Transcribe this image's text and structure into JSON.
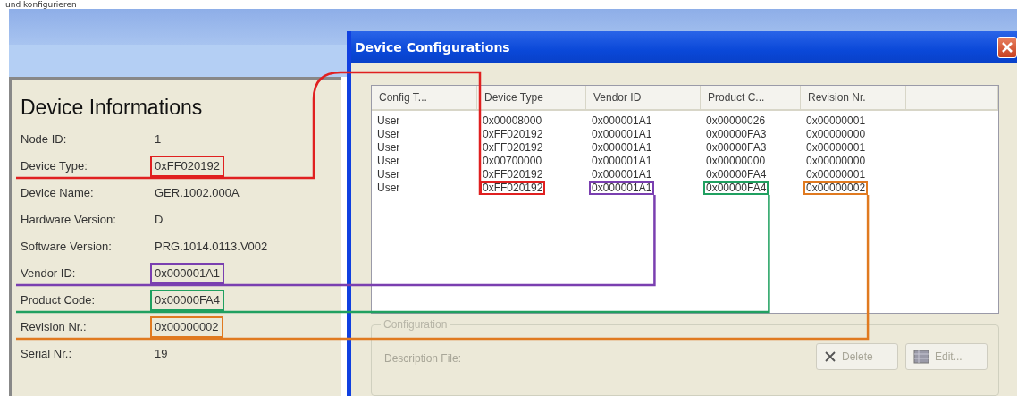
{
  "top_note": "und konfigurieren",
  "device_info": {
    "title": "Device Informations",
    "rows": [
      {
        "label": "Node ID:",
        "value": "1"
      },
      {
        "label": "Device Type:",
        "value": "0xFF020192",
        "color": "#e02020"
      },
      {
        "label": "Device Name:",
        "value": "GER.1002.000A"
      },
      {
        "label": "Hardware Version:",
        "value": "D"
      },
      {
        "label": "Software Version:",
        "value": "PRG.1014.0113.V002"
      },
      {
        "label": "Vendor ID:",
        "value": "0x000001A1",
        "color": "#7a3fb0"
      },
      {
        "label": "Product Code:",
        "value": "0x00000FA4",
        "color": "#20a060"
      },
      {
        "label": "Revision Nr.:",
        "value": "0x00000002",
        "color": "#e07a20"
      },
      {
        "label": "Serial Nr.:",
        "value": "19"
      }
    ]
  },
  "dialog": {
    "title": "Device Configurations",
    "table": {
      "columns": [
        "Config T...",
        "Device Type",
        "Vendor ID",
        "Product C...",
        "Revision Nr."
      ],
      "rows": [
        {
          "cells": [
            {
              "text": "User"
            },
            {
              "text": "0x00008000"
            },
            {
              "text": "0x000001A1"
            },
            {
              "text": "0x00000026"
            },
            {
              "text": "0x00000001"
            }
          ]
        },
        {
          "cells": [
            {
              "text": "User"
            },
            {
              "text": "0xFF020192"
            },
            {
              "text": "0x000001A1"
            },
            {
              "text": "0x00000FA3"
            },
            {
              "text": "0x00000000"
            }
          ]
        },
        {
          "cells": [
            {
              "text": "User"
            },
            {
              "text": "0xFF020192"
            },
            {
              "text": "0x000001A1"
            },
            {
              "text": "0x00000FA3"
            },
            {
              "text": "0x00000001"
            }
          ]
        },
        {
          "cells": [
            {
              "text": "User"
            },
            {
              "text": "0x00700000"
            },
            {
              "text": "0x000001A1"
            },
            {
              "text": "0x00000000"
            },
            {
              "text": "0x00000000"
            }
          ]
        },
        {
          "cells": [
            {
              "text": "User"
            },
            {
              "text": "0xFF020192"
            },
            {
              "text": "0x000001A1"
            },
            {
              "text": "0x00000FA4"
            },
            {
              "text": "0x00000001"
            }
          ]
        },
        {
          "cells": [
            {
              "text": "User"
            },
            {
              "text": "0xFF020192",
              "color": "#e02020"
            },
            {
              "text": "0x000001A1",
              "color": "#7a3fb0"
            },
            {
              "text": "0x00000FA4",
              "color": "#20a060"
            },
            {
              "text": "0x00000002",
              "color": "#e07a20"
            }
          ]
        }
      ]
    },
    "configuration": {
      "legend": "Configuration",
      "fields": [
        {
          "label": "Description File:"
        }
      ],
      "buttons": [
        {
          "label": "Delete",
          "kind": "delete",
          "disabled": true
        },
        {
          "label": "Edit...",
          "kind": "edit",
          "disabled": true
        }
      ]
    }
  }
}
